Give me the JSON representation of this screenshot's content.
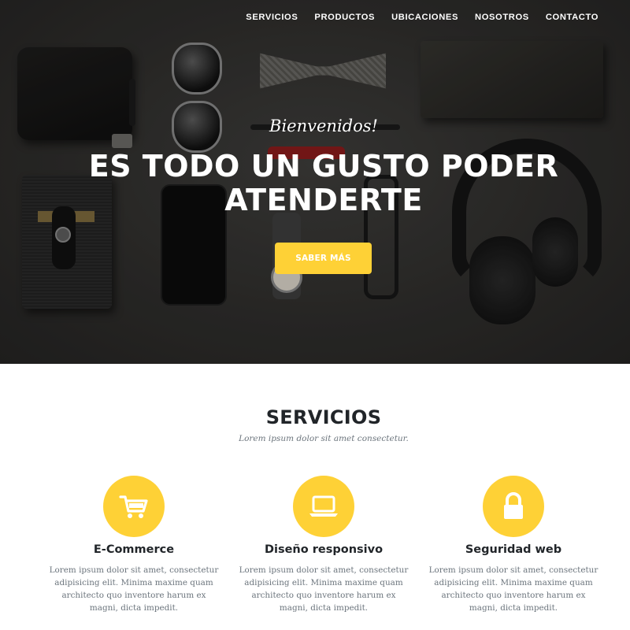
{
  "nav": {
    "items": [
      "SERVICIOS",
      "PRODUCTOS",
      "UBICACIONES",
      "NOSOTROS",
      "CONTACTO"
    ]
  },
  "hero": {
    "welcome": "Bienvenidos!",
    "headline_line1": "ES TODO UN GUSTO PODER",
    "headline_line2": "ATENDERTE",
    "cta_label": "SABER MÁS"
  },
  "services": {
    "title": "SERVICIOS",
    "subtitle": "Lorem ipsum dolor sit amet consectetur.",
    "items": [
      {
        "icon": "shopping-cart-icon",
        "title": "E-Commerce",
        "text": "Lorem ipsum dolor sit amet, consectetur adipisicing elit. Minima maxime quam architecto quo inventore harum ex magni, dicta impedit."
      },
      {
        "icon": "laptop-icon",
        "title": "Diseño responsivo",
        "text": "Lorem ipsum dolor sit amet, consectetur adipisicing elit. Minima maxime quam architecto quo inventore harum ex magni, dicta impedit."
      },
      {
        "icon": "lock-icon",
        "title": "Seguridad web",
        "text": "Lorem ipsum dolor sit amet, consectetur adipisicing elit. Minima maxime quam architecto quo inventore harum ex magni, dicta impedit."
      }
    ]
  },
  "colors": {
    "accent": "#fed136",
    "heading": "#212529",
    "muted": "#6c757d"
  }
}
